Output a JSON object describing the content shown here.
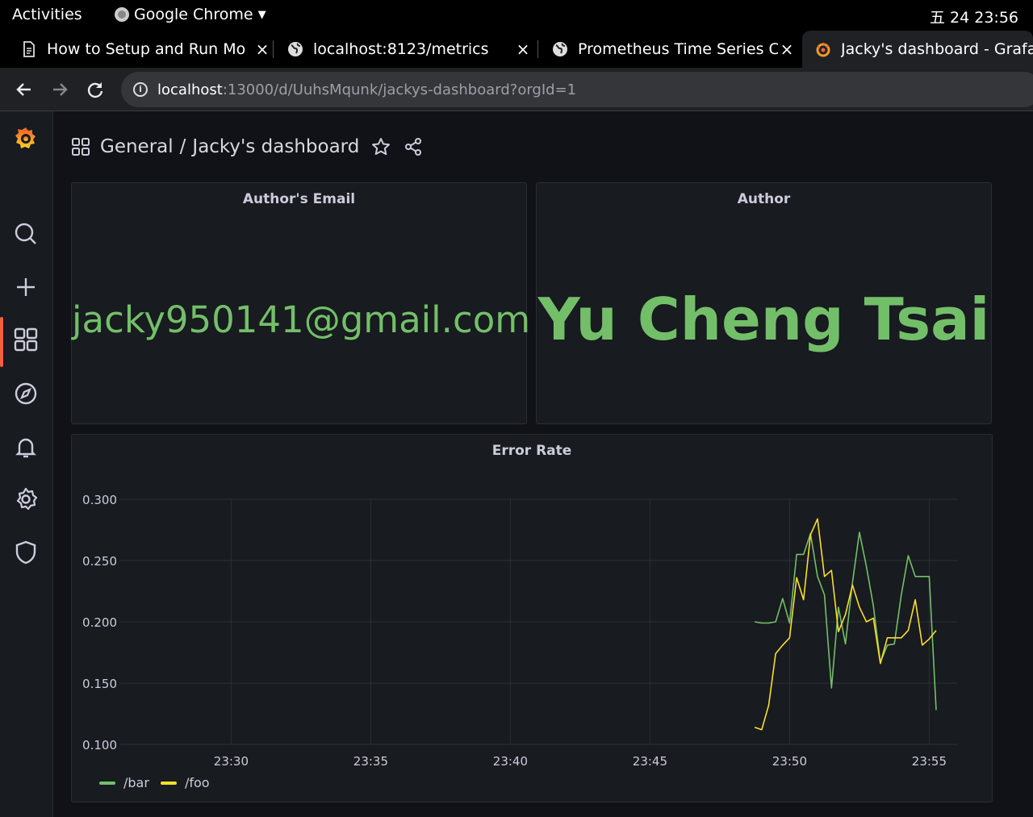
{
  "os_bar": {
    "activities": "Activities",
    "app_name": "Google Chrome",
    "clock": "五 24 23:56"
  },
  "tabs": [
    {
      "title": "How to Setup and Run Mo",
      "icon": "document-icon"
    },
    {
      "title": "localhost:8123/metrics",
      "icon": "globe-icon"
    },
    {
      "title": "Prometheus Time Series C",
      "icon": "globe-icon"
    },
    {
      "title": "Jacky's dashboard - Grafa",
      "icon": "grafana-icon",
      "active": true
    }
  ],
  "tab_close_glyph": "×",
  "address_bar": {
    "host": "localhost",
    "path": ":13000/d/UuhsMqunk/jackys-dashboard?orgId=1"
  },
  "breadcrumb": {
    "folder": "General",
    "separator": "/",
    "title": "Jacky's dashboard"
  },
  "panels": {
    "email": {
      "title": "Author's Email",
      "value": "jacky950141@gmail.com"
    },
    "author": {
      "title": "Author",
      "value": "Yu Cheng Tsai"
    },
    "error_rate": {
      "title": "Error Rate"
    }
  },
  "colors": {
    "stat_green": "#73bf69",
    "series_bar": "#73bf69",
    "series_foo": "#fade2a",
    "grafana_accent": "#f55f3e"
  },
  "chart_data": {
    "type": "line",
    "title": "Error Rate",
    "x_ticks": [
      "23:30",
      "23:35",
      "23:40",
      "23:45",
      "23:50",
      "23:55"
    ],
    "x_range": [
      "23:26",
      "23:56"
    ],
    "y_ticks": [
      "0.100",
      "0.150",
      "0.200",
      "0.250",
      "0.300"
    ],
    "ylim": [
      0.1,
      0.3
    ],
    "grid": true,
    "legend_position": "bottom-left",
    "series": [
      {
        "name": "/bar",
        "color": "#73bf69",
        "x": [
          "23:48:45",
          "23:49:00",
          "23:49:15",
          "23:49:30",
          "23:49:45",
          "23:50:00",
          "23:50:15",
          "23:50:30",
          "23:50:45",
          "23:51:00",
          "23:51:15",
          "23:51:30",
          "23:51:45",
          "23:52:00",
          "23:52:15",
          "23:52:30",
          "23:52:45",
          "23:53:00",
          "23:53:15",
          "23:53:30",
          "23:53:45",
          "23:54:00",
          "23:54:15",
          "23:54:30",
          "23:54:45",
          "23:55:00",
          "23:55:15"
        ],
        "values": [
          0.2,
          0.199,
          0.199,
          0.2,
          0.219,
          0.199,
          0.255,
          0.255,
          0.272,
          0.237,
          0.222,
          0.146,
          0.212,
          0.182,
          0.232,
          0.273,
          0.245,
          0.213,
          0.167,
          0.181,
          0.182,
          0.222,
          0.254,
          0.237,
          0.237,
          0.237,
          0.128
        ]
      },
      {
        "name": "/foo",
        "color": "#fade2a",
        "x": [
          "23:48:45",
          "23:49:00",
          "23:49:15",
          "23:49:30",
          "23:49:45",
          "23:50:00",
          "23:50:15",
          "23:50:30",
          "23:50:45",
          "23:51:00",
          "23:51:15",
          "23:51:30",
          "23:51:45",
          "23:52:00",
          "23:52:15",
          "23:52:30",
          "23:52:45",
          "23:53:00",
          "23:53:15",
          "23:53:30",
          "23:53:45",
          "23:54:00",
          "23:54:15",
          "23:54:30",
          "23:54:45",
          "23:55:00",
          "23:55:15"
        ],
        "values": [
          0.114,
          0.112,
          0.132,
          0.174,
          0.181,
          0.187,
          0.236,
          0.218,
          0.271,
          0.284,
          0.237,
          0.242,
          0.192,
          0.206,
          0.23,
          0.212,
          0.2,
          0.203,
          0.166,
          0.187,
          0.187,
          0.187,
          0.193,
          0.218,
          0.181,
          0.186,
          0.193
        ]
      }
    ]
  }
}
